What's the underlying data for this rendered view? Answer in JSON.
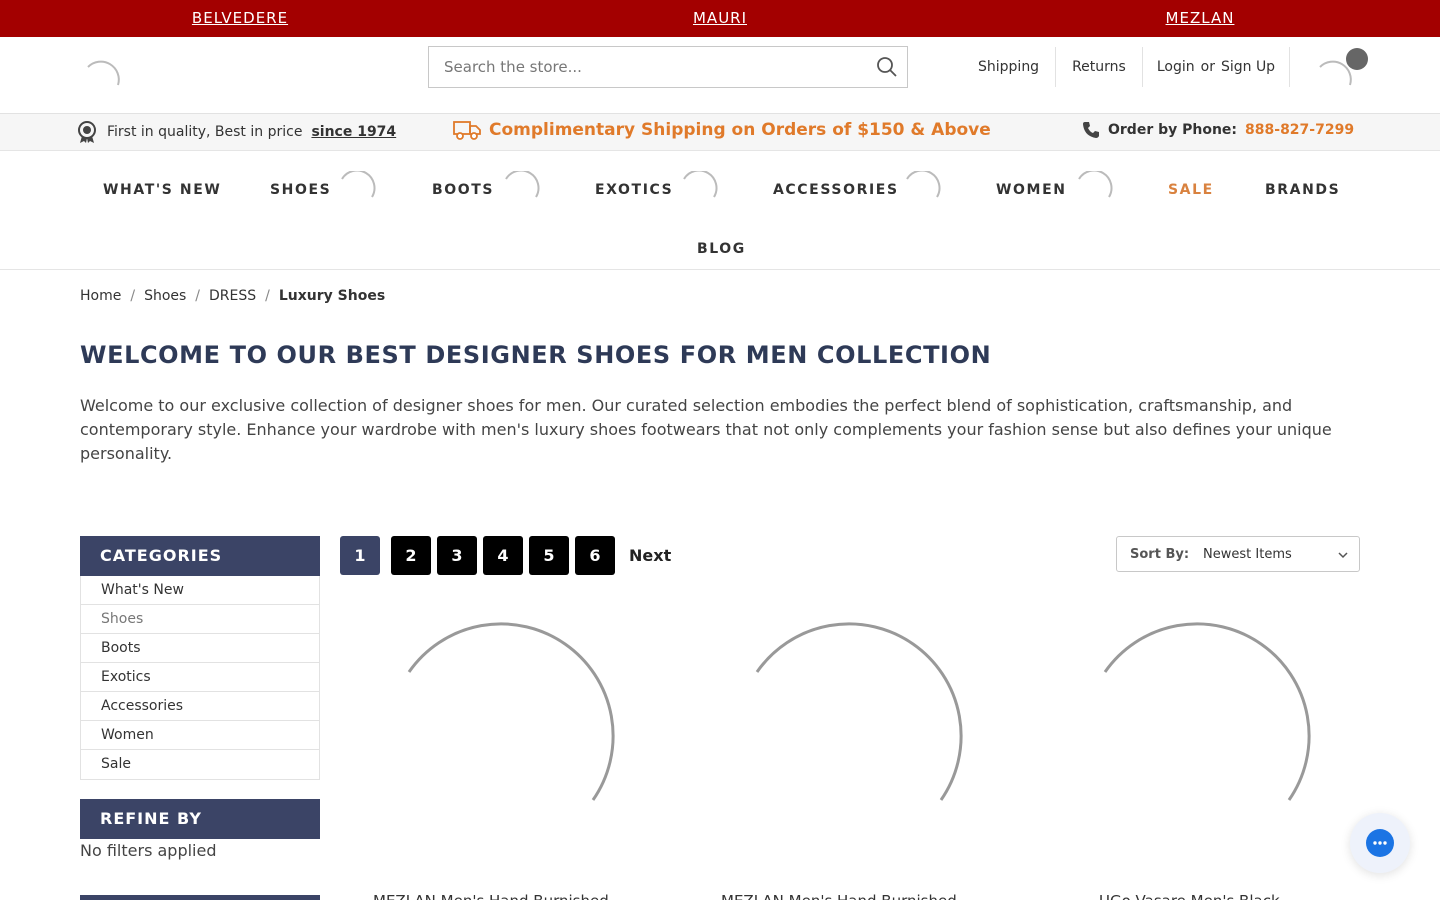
{
  "brand_bar": {
    "items": [
      {
        "label": "BELVEDERE"
      },
      {
        "label": "MAURI"
      },
      {
        "label": "MEZLAN"
      }
    ],
    "background": "#a30000"
  },
  "header": {
    "search_placeholder": "Search the store...",
    "shipping": "Shipping",
    "returns": "Returns",
    "login": "Login",
    "or": "or",
    "signup": "Sign Up"
  },
  "promo": {
    "quality_text": "First in quality, Best in price",
    "since": "since 1974",
    "shipping_text": "Complimentary Shipping on Orders of $150 & Above",
    "phone_label": "Order by Phone:",
    "phone_number": "888-827-7299",
    "accent": "#e07a2a"
  },
  "nav": {
    "items": [
      {
        "label": "WHAT'S NEW"
      },
      {
        "label": "SHOES"
      },
      {
        "label": "BOOTS"
      },
      {
        "label": "EXOTICS"
      },
      {
        "label": "ACCESSORIES"
      },
      {
        "label": "WOMEN"
      },
      {
        "label": "SALE"
      },
      {
        "label": "BRANDS"
      },
      {
        "label": "BLOG"
      }
    ]
  },
  "breadcrumb": {
    "items": [
      "Home",
      "Shoes",
      "DRESS"
    ],
    "separator": "/",
    "current": "Luxury Shoes"
  },
  "page": {
    "title": "WELCOME TO OUR BEST DESIGNER SHOES FOR MEN COLLECTION",
    "description": "Welcome to our exclusive collection of designer shoes for men. Our curated selection embodies the perfect blend of sophistication, craftsmanship, and contemporary style. Enhance your wardrobe with men's luxury shoes footwears that not only complements your fashion sense but also defines your unique personality."
  },
  "sidebar": {
    "categories_heading": "CATEGORIES",
    "categories": [
      {
        "label": "What's New"
      },
      {
        "label": "Shoes"
      },
      {
        "label": "Boots"
      },
      {
        "label": "Exotics"
      },
      {
        "label": "Accessories"
      },
      {
        "label": "Women"
      },
      {
        "label": "Sale"
      }
    ],
    "active_category": "Shoes",
    "refine_heading": "REFINE BY",
    "no_filters": "No filters applied",
    "heading_color": "#3b4466"
  },
  "pagination": {
    "pages": [
      "1",
      "2",
      "3",
      "4",
      "5",
      "6"
    ],
    "current": "1",
    "next": "Next"
  },
  "sort": {
    "label": "Sort By:",
    "value": "Newest Items"
  },
  "products": [
    {
      "title": "MEZLAN Men's Hand Burnished"
    },
    {
      "title": "MEZLAN Men's Hand Burnished"
    },
    {
      "title": "UGo Vasare Men's Black"
    }
  ],
  "chat": {
    "icon": "chat-bubble-icon"
  }
}
